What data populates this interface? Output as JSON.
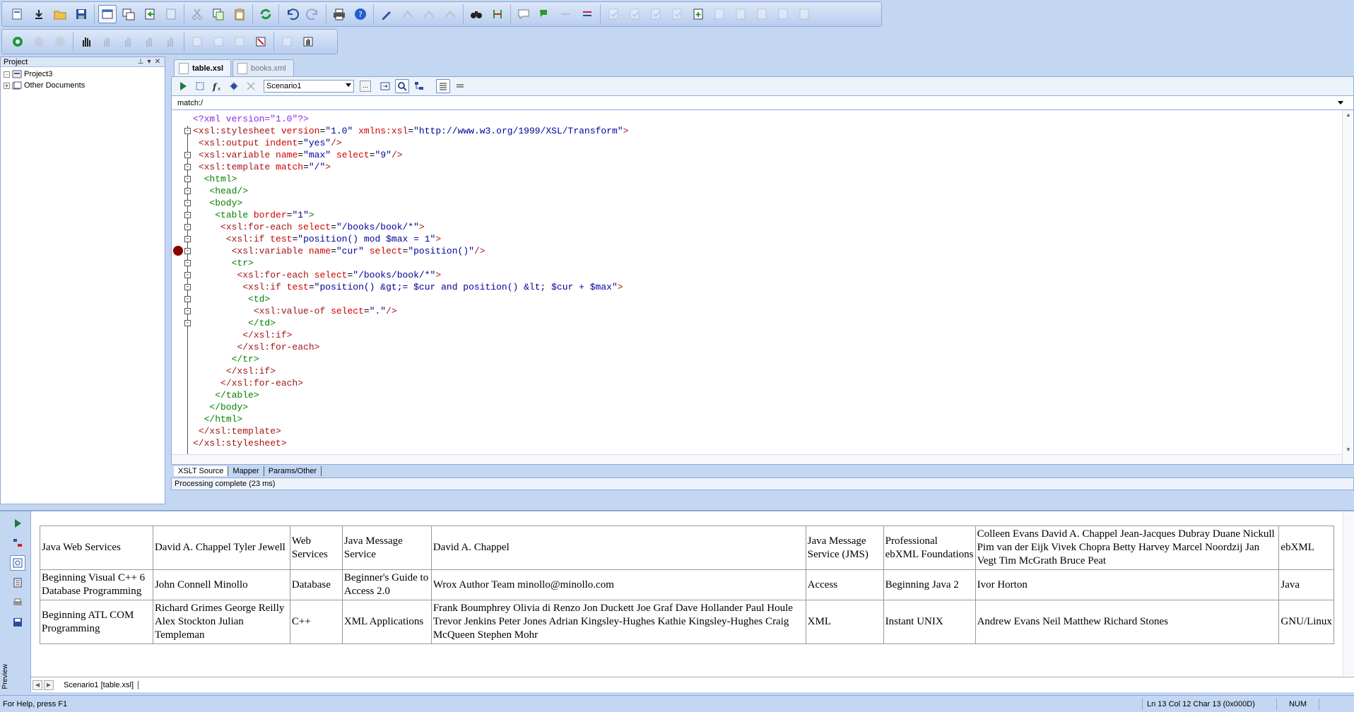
{
  "project_panel": {
    "title": "Project",
    "tree": [
      {
        "label": "Project3",
        "expander": "-"
      },
      {
        "label": "Other Documents",
        "expander": "+"
      }
    ]
  },
  "doc_tabs": [
    {
      "label": "table.xsl",
      "active": true
    },
    {
      "label": "books.xml",
      "active": false
    }
  ],
  "xslt_toolbar": {
    "scenario": "Scenario1",
    "more_button": "..."
  },
  "match_bar": "match:/",
  "code_lines": [
    "<?xml version=\"1.0\"?>",
    "<xsl:stylesheet version=\"1.0\" xmlns:xsl=\"http://www.w3.org/1999/XSL/Transform\">",
    " <xsl:output indent=\"yes\"/>",
    " <xsl:variable name=\"max\" select=\"9\"/>",
    " <xsl:template match=\"/\">",
    "  <html>",
    "   <head/>",
    "   <body>",
    "    <table border=\"1\">",
    "     <xsl:for-each select=\"/books/book/*\">",
    "      <xsl:if test=\"position() mod $max = 1\">",
    "       <xsl:variable name=\"cur\" select=\"position()\"/>",
    "       <tr>",
    "        <xsl:for-each select=\"/books/book/*\">",
    "         <xsl:if test=\"position() &gt;= $cur and position() &lt; $cur + $max\">",
    "          <td>",
    "           <xsl:value-of select=\".\"/>",
    "          </td>",
    "         </xsl:if>",
    "        </xsl:for-each>",
    "       </tr>",
    "      </xsl:if>",
    "     </xsl:for-each>",
    "    </table>",
    "   </body>",
    "  </html>",
    " </xsl:template>",
    "</xsl:stylesheet>"
  ],
  "breakpoint_line": 12,
  "view_tabs": [
    "XSLT Source",
    "Mapper",
    "Params/Other"
  ],
  "processing_status": "Processing complete (23 ms)",
  "preview": {
    "label": "Preview",
    "rows": [
      [
        "Java Web Services",
        "David A. Chappel Tyler Jewell",
        "Web Services",
        "Java Message Service",
        "David A. Chappel",
        "Java Message Service (JMS)",
        "Professional ebXML Foundations",
        "Colleen Evans David A. Chappel Jean-Jacques Dubray Duane Nickull Pim van der Eijk Vivek Chopra Betty Harvey Marcel Noordzij Jan Vegt Tim McGrath Bruce Peat",
        "ebXML"
      ],
      [
        "Beginning Visual C++ 6 Database Programming",
        "John Connell Minollo",
        "Database",
        "Beginner's Guide to Access 2.0",
        "Wrox Author Team minollo@minollo.com",
        "Access",
        "Beginning Java 2",
        "Ivor Horton",
        "Java"
      ],
      [
        "Beginning ATL COM Programming",
        "Richard Grimes George Reilly Alex Stockton Julian Templeman",
        "C++",
        "XML Applications",
        "Frank Boumphrey Olivia di Renzo Jon Duckett Joe Graf Dave Hollander Paul Houle Trevor Jenkins Peter Jones Adrian Kingsley-Hughes Kathie Kingsley-Hughes Craig McQueen Stephen Mohr",
        "XML",
        "Instant UNIX",
        "Andrew Evans Neil Matthew Richard Stones",
        "GNU/Linux"
      ]
    ],
    "tab": "Scenario1 [table.xsl]"
  },
  "status_bar": {
    "help": "For Help, press F1",
    "position": "Ln 13 Col 12  Char 13 (0x000D)",
    "num": "NUM"
  },
  "colors": {
    "background": "#c4d7f2",
    "breakpoint": "#8b0000",
    "xsl_tag": "#a31515",
    "html_tag": "#008000",
    "attr": "#d00000",
    "value": "#00009a"
  }
}
